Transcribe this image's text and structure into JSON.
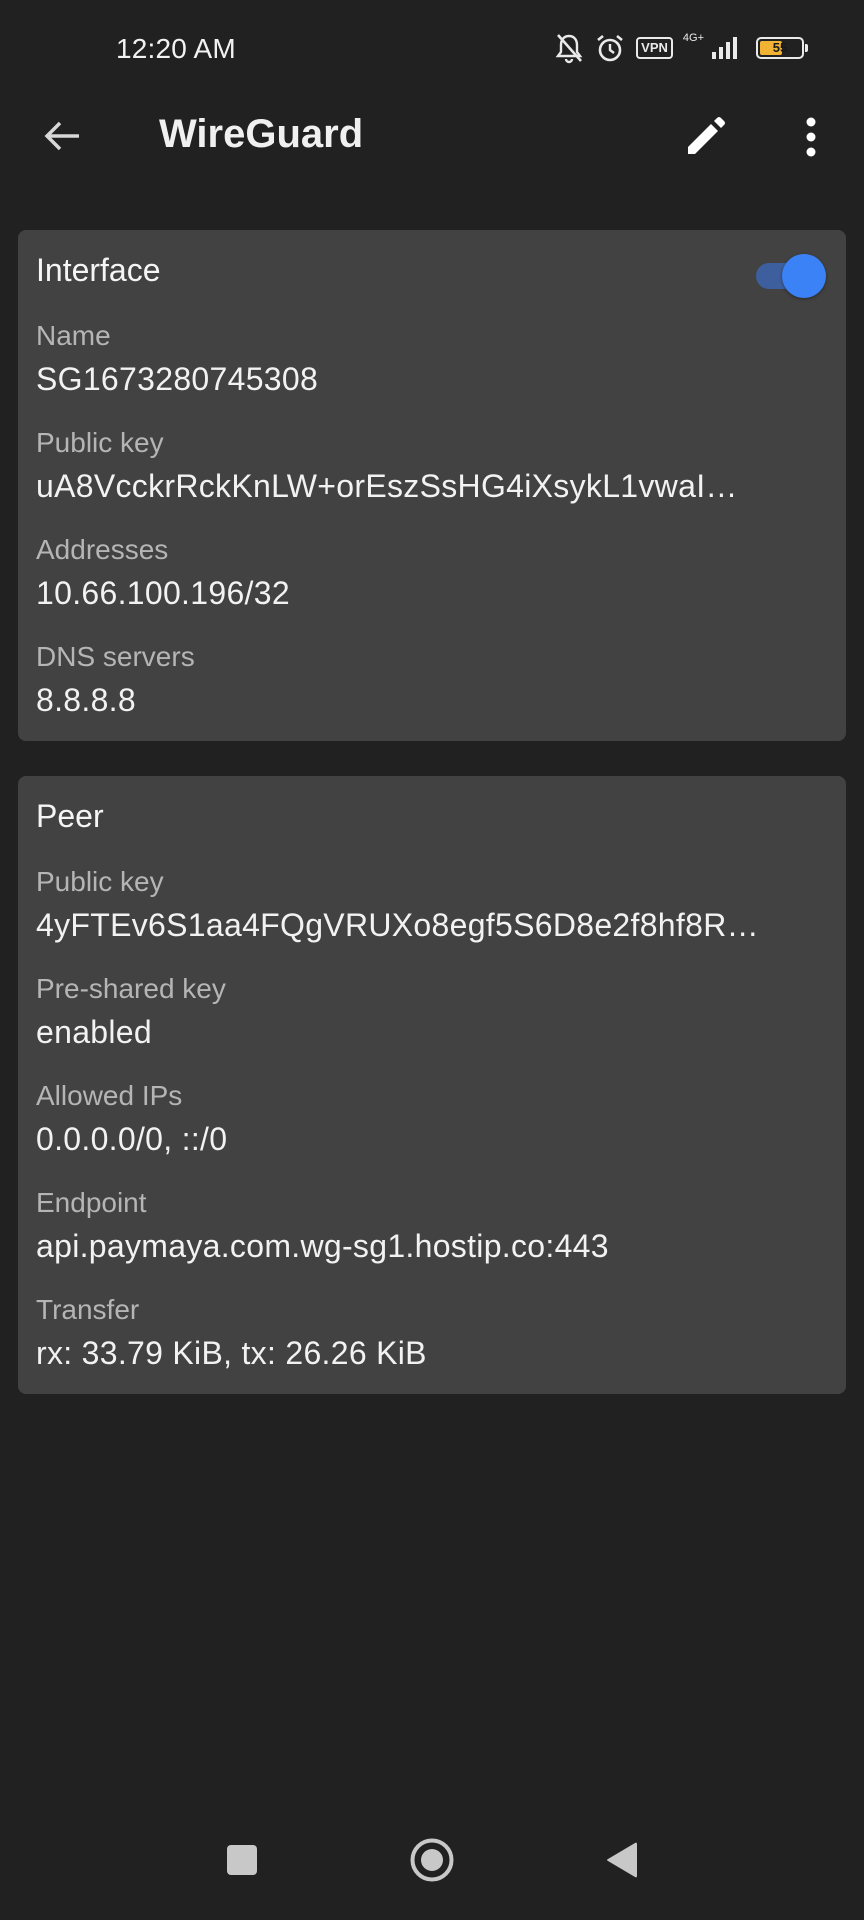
{
  "status_bar": {
    "time": "12:20 AM",
    "icons": [
      "notifications-off-icon",
      "alarm-icon",
      "vpn-icon",
      "signal-icon",
      "battery-icon"
    ],
    "vpn_label": "VPN",
    "network_type": "4G+",
    "battery_level": "55",
    "battery_fraction": 0.55,
    "battery_color": "#f2b233"
  },
  "app_bar": {
    "title": "WireGuard",
    "icons": [
      "back-arrow-icon",
      "pencil-icon",
      "more-vert-icon"
    ]
  },
  "interface": {
    "title": "Interface",
    "toggle_on": true,
    "accent_color": "#3b82f6",
    "fields": [
      {
        "label": "Name",
        "value": "SG1673280745308"
      },
      {
        "label": "Public key",
        "value": "uA8VcckrRckKnLW+orEszSsHG4iXsykL1vwaI…"
      },
      {
        "label": "Addresses",
        "value": "10.66.100.196/32"
      },
      {
        "label": "DNS servers",
        "value": "8.8.8.8"
      }
    ]
  },
  "peer": {
    "title": "Peer",
    "fields": [
      {
        "label": "Public key",
        "value": "4yFTEv6S1aa4FQgVRUXo8egf5S6D8e2f8hf8R…"
      },
      {
        "label": "Pre-shared key",
        "value": "enabled"
      },
      {
        "label": "Allowed IPs",
        "value": "0.0.0.0/0, ::/0"
      },
      {
        "label": "Endpoint",
        "value": "api.paymaya.com.wg-sg1.hostip.co:443"
      },
      {
        "label": "Transfer",
        "value": "rx: 33.79 KiB, tx: 26.26 KiB"
      }
    ]
  },
  "nav_bar": {
    "icons": [
      "recents-square-icon",
      "home-circle-icon",
      "back-triangle-icon"
    ]
  },
  "colors": {
    "background": "#212121",
    "card": "#424242",
    "label_text": "#b5b5b5"
  }
}
